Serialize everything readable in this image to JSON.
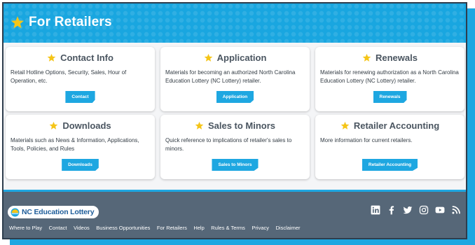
{
  "header": {
    "title": "For Retailers"
  },
  "cards": [
    {
      "title": "Contact Info",
      "description": "Retail Hotline Options, Security, Sales, Hour of Operation, etc.",
      "button": "Contact"
    },
    {
      "title": "Application",
      "description": "Materials for becoming an authorized North Carolina Education Lottery (NC Lottery) retailer.",
      "button": "Application"
    },
    {
      "title": "Renewals",
      "description": "Materials for renewing authorization as a North Carolina Education Lottery (NC Lottery) retailer.",
      "button": "Renewals"
    },
    {
      "title": "Downloads",
      "description": "Materials such as News & Information, Applications, Tools, Policies, and Rules",
      "button": "Downloads"
    },
    {
      "title": "Sales to Minors",
      "description": "Quick reference to implications of retailer's sales to minors.",
      "button": "Sales to Minors"
    },
    {
      "title": "Retailer Accounting",
      "description": "More information for current retailers.",
      "button": "Retailer Accounting"
    }
  ],
  "footer": {
    "logo_text": "NC Education Lottery",
    "social": [
      "linkedin-icon",
      "facebook-icon",
      "twitter-icon",
      "instagram-icon",
      "youtube-icon",
      "rss-icon"
    ],
    "links": [
      "Where to Play",
      "Contact",
      "Videos",
      "Business Opportunities",
      "For Retailers",
      "Help",
      "Rules & Terms",
      "Privacy",
      "Disclaimer"
    ]
  },
  "colors": {
    "accent": "#1ea7e1",
    "star": "#f5c518",
    "footer": "#566778",
    "frame_border": "#2e3d4d"
  }
}
